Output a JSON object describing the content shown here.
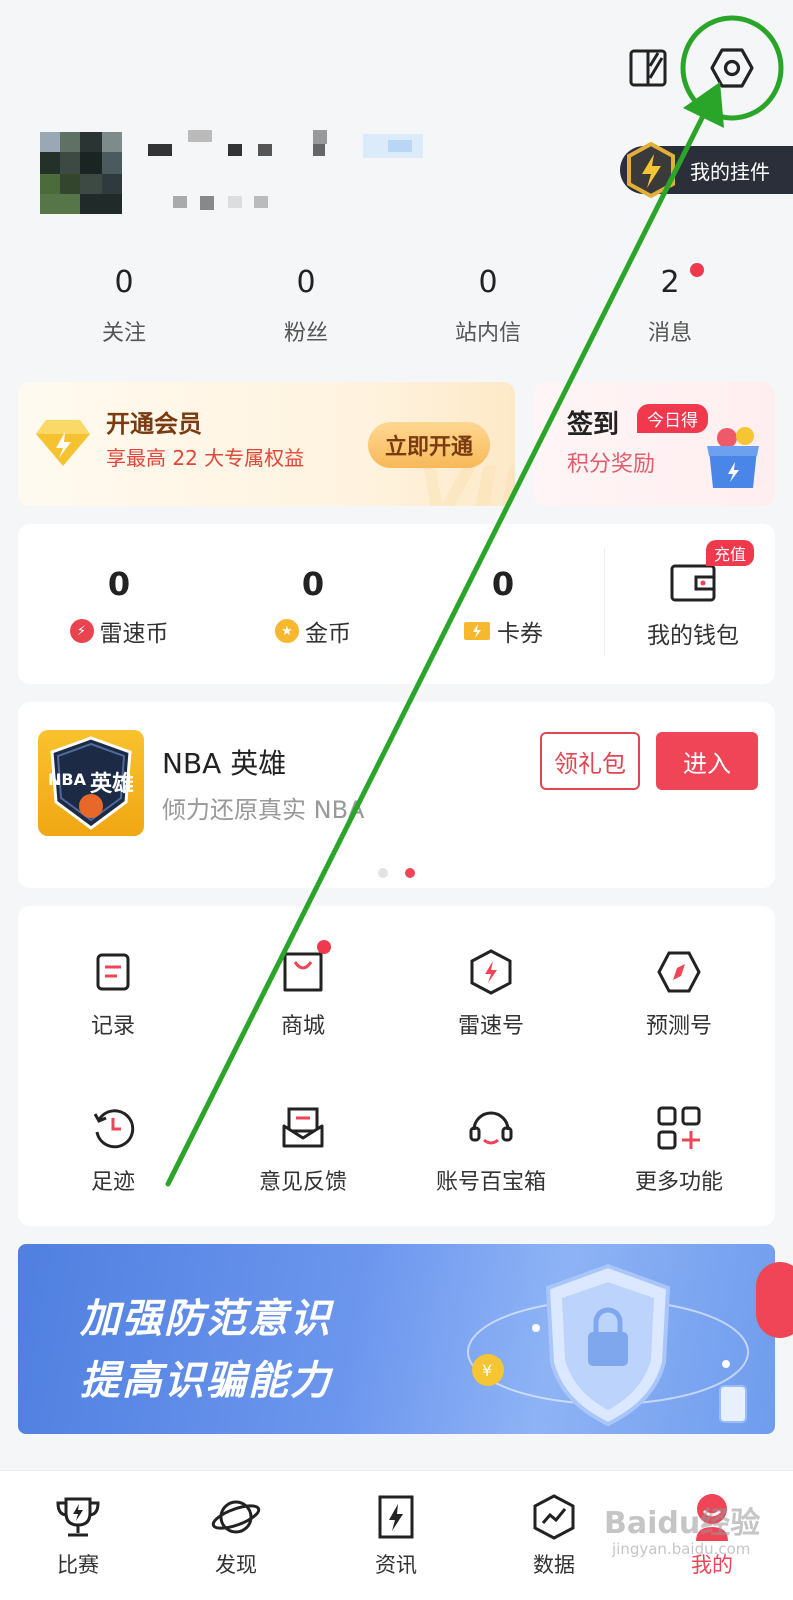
{
  "header": {
    "widget_label": "我的挂件",
    "icons": [
      "skin-icon",
      "settings-icon"
    ]
  },
  "stats": [
    {
      "value": "0",
      "label": "关注"
    },
    {
      "value": "0",
      "label": "粉丝"
    },
    {
      "value": "0",
      "label": "站内信"
    },
    {
      "value": "2",
      "label": "消息"
    }
  ],
  "vip": {
    "title": "开通会员",
    "subtitle": "享最高 22 大专属权益",
    "button": "立即开通"
  },
  "signin": {
    "title": "签到",
    "badge": "今日得",
    "subtitle": "积分奖励"
  },
  "wallet": {
    "items": [
      {
        "value": "0",
        "label": "雷速币"
      },
      {
        "value": "0",
        "label": "金币"
      },
      {
        "value": "0",
        "label": "卡券"
      }
    ],
    "wallet_label": "我的钱包",
    "recharge_badge": "充值"
  },
  "game": {
    "logo_text": "英雄",
    "logo_brand": "NBA",
    "title": "NBA 英雄",
    "subtitle": "倾力还原真实 NBA",
    "gift_button": "领礼包",
    "enter_button": "进入"
  },
  "features": [
    {
      "label": "记录",
      "icon": "record-icon"
    },
    {
      "label": "商城",
      "icon": "shop-bag-icon"
    },
    {
      "label": "雷速号",
      "icon": "leisu-account-icon"
    },
    {
      "label": "预测号",
      "icon": "prediction-icon"
    },
    {
      "label": "足迹",
      "icon": "history-icon"
    },
    {
      "label": "意见反馈",
      "icon": "feedback-icon"
    },
    {
      "label": "账号百宝箱",
      "icon": "support-headset-icon"
    },
    {
      "label": "更多功能",
      "icon": "more-grid-icon"
    }
  ],
  "banner": {
    "line1": "加强防范意识",
    "line2": "提高识骗能力"
  },
  "tabs": [
    {
      "label": "比赛",
      "icon": "trophy-icon"
    },
    {
      "label": "发现",
      "icon": "planet-icon"
    },
    {
      "label": "资讯",
      "icon": "news-icon"
    },
    {
      "label": "数据",
      "icon": "data-icon"
    },
    {
      "label": "我的",
      "icon": "profile-icon"
    }
  ],
  "watermark": {
    "brand": "Baidu经验",
    "url": "jingyan.baidu.com"
  },
  "colors": {
    "accent_red": "#ef4557",
    "vip_gold": "#f7b959",
    "annotation_green": "#2aa52a"
  }
}
